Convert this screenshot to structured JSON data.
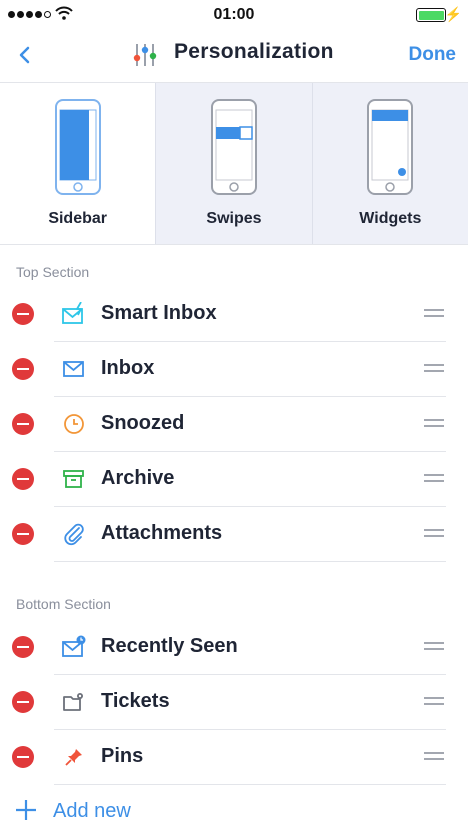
{
  "status_bar": {
    "time": "01:00",
    "battery_level": 1.0
  },
  "navbar": {
    "back_icon": "chevron-left-icon",
    "title_icon": "sliders-icon",
    "title": "Personalization",
    "done_label": "Done"
  },
  "tabs": [
    {
      "label": "Sidebar",
      "icon": "phone-sidebar-icon",
      "selected": true
    },
    {
      "label": "Swipes",
      "icon": "phone-swipes-icon",
      "selected": false
    },
    {
      "label": "Widgets",
      "icon": "phone-widgets-icon",
      "selected": false
    }
  ],
  "top_section": {
    "header": "Top Section",
    "items": [
      {
        "label": "Smart Inbox",
        "icon": "smart-inbox-icon",
        "color": "#2ec6e8"
      },
      {
        "label": "Inbox",
        "icon": "envelope-icon",
        "color": "#3d8fe6"
      },
      {
        "label": "Snoozed",
        "icon": "clock-icon",
        "color": "#f29638"
      },
      {
        "label": "Archive",
        "icon": "archive-box-icon",
        "color": "#2fb24a"
      },
      {
        "label": "Attachments",
        "icon": "paperclip-icon",
        "color": "#3d8fe6"
      }
    ]
  },
  "bottom_section": {
    "header": "Bottom Section",
    "items": [
      {
        "label": "Recently Seen",
        "icon": "envelope-clock-icon",
        "color": "#3d8fe6"
      },
      {
        "label": "Tickets",
        "icon": "folder-gear-icon",
        "color": "#6c707a"
      },
      {
        "label": "Pins",
        "icon": "pin-icon",
        "color": "#f0543a"
      }
    ]
  },
  "add_new": {
    "label": "Add new",
    "icon": "plus-icon"
  },
  "colors": {
    "accent": "#3d8fe6",
    "delete": "#e0393a"
  }
}
